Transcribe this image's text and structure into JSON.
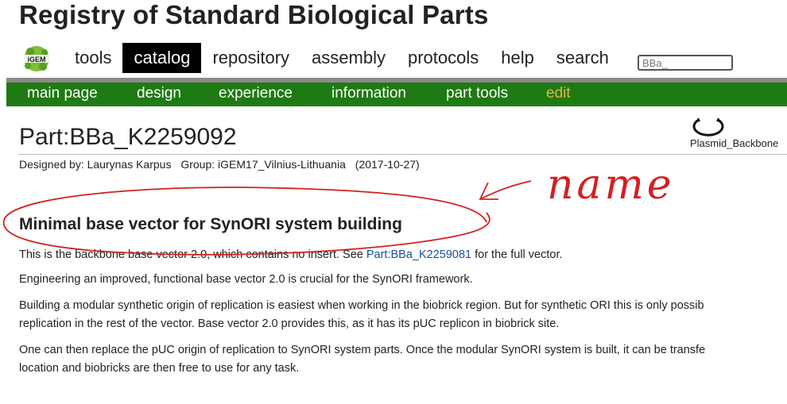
{
  "site": {
    "title": "Registry of Standard Biological Parts"
  },
  "logo": {
    "text": "iGEM"
  },
  "topnav": {
    "items": [
      {
        "label": "tools",
        "active": false
      },
      {
        "label": "catalog",
        "active": true
      },
      {
        "label": "repository",
        "active": false
      },
      {
        "label": "assembly",
        "active": false
      },
      {
        "label": "protocols",
        "active": false
      },
      {
        "label": "help",
        "active": false
      },
      {
        "label": "search",
        "active": false
      }
    ],
    "search_value": "BBa_"
  },
  "subnav": {
    "items": [
      "main page",
      "design",
      "experience",
      "information",
      "part tools",
      "edit"
    ]
  },
  "part": {
    "title": "Part:BBa_K2259092",
    "designed_by": "Designed by: Laurynas Karpus",
    "group": "Group: iGEM17_Vilnius-Lithuania",
    "date": "(2017-10-27)",
    "icon_label": "Plasmid_Backbone"
  },
  "content": {
    "heading": "Minimal base vector for SynORI system building",
    "p1_before": "This is the backbone base vector 2.0, which contains no insert. See ",
    "p1_link": "Part:BBa_K2259081",
    "p1_after": " for the full vector.",
    "p2": "Engineering an improved, functional base vector 2.0 is crucial for the SynORI framework.",
    "p3_line1": "Building a modular synthetic origin of replication is easiest when working in the biobrick region. But for synthetic ORI this is only possib",
    "p3_line2": "replication in the rest of the vector. Base vector 2.0 provides this, as it has its pUC replicon in biobrick site.",
    "p4_line1": "One can then replace the pUC origin of replication to SynORI system parts. Once the modular SynORI system is built, it can be transfe",
    "p4_line2": "location and biobricks are then free to use for any task."
  },
  "annotation": {
    "text": "name",
    "color": "#d42020"
  }
}
